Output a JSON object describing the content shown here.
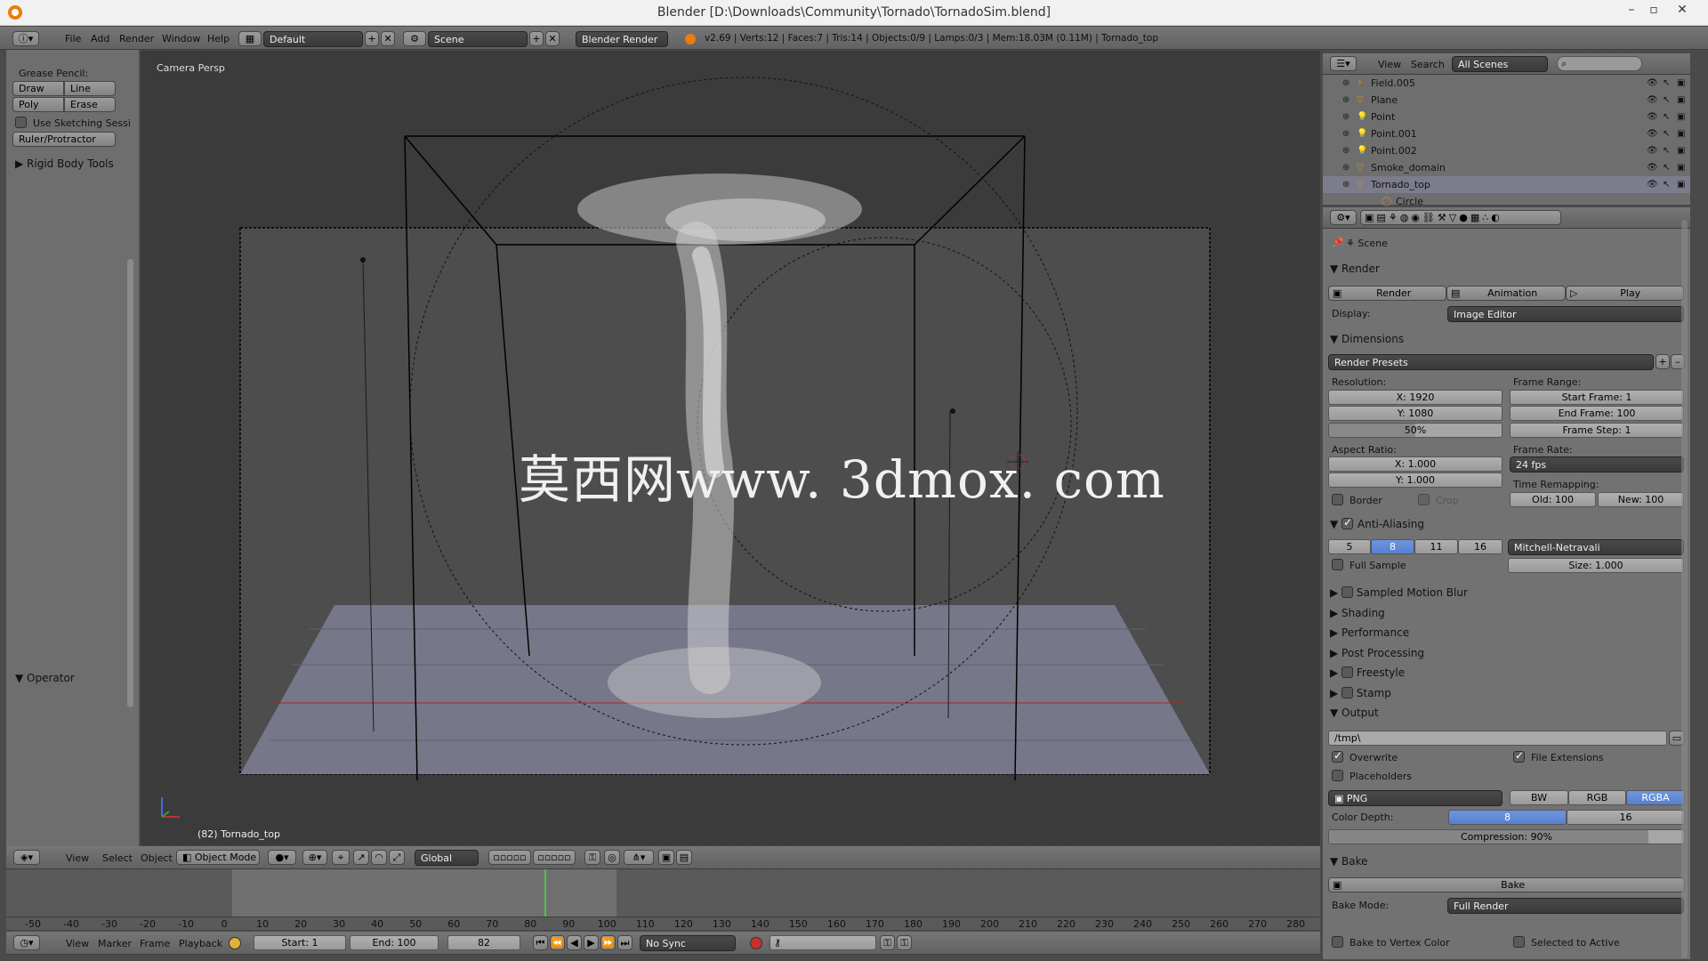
{
  "window": {
    "title": "Blender [D:\\Downloads\\Community\\Tornado\\TornadoSim.blend]"
  },
  "topbar": {
    "menus": [
      "File",
      "Add",
      "Render",
      "Window",
      "Help"
    ],
    "layout": "Default",
    "scene": "Scene",
    "engine": "Blender Render",
    "stats": "v2.69 | Verts:12 | Faces:7 | Tris:14 | Objects:0/9 | Lamps:0/3 | Mem:18.03M (0.11M) | Tornado_top"
  },
  "toolshelf": {
    "grease_pencil": "Grease Pencil:",
    "draw": "Draw",
    "line": "Line",
    "poly": "Poly",
    "erase": "Erase",
    "sketching": "Use Sketching Sessi",
    "ruler": "Ruler/Protractor",
    "rigid_body": "Rigid Body Tools",
    "operator": "Operator"
  },
  "viewport": {
    "persp_label": "Camera Persp",
    "object_label": "(82) Tornado_top",
    "watermark": "莫西网www. 3dmox. com",
    "header": {
      "menus": [
        "View",
        "Select",
        "Object"
      ],
      "mode": "Object Mode",
      "orientation": "Global"
    }
  },
  "outliner": {
    "menus": [
      "View",
      "Search"
    ],
    "scene_filter": "All Scenes",
    "items": [
      "Field.005",
      "Plane",
      "Point",
      "Point.001",
      "Point.002",
      "Smoke_domain",
      "Tornado_top",
      "Circle"
    ]
  },
  "properties": {
    "context": "Scene",
    "render": {
      "title": "Render",
      "render_btn": "Render",
      "animation_btn": "Animation",
      "play_btn": "Play",
      "display_label": "Display:",
      "display_value": "Image Editor"
    },
    "dimensions": {
      "title": "Dimensions",
      "presets": "Render Presets",
      "resolution_label": "Resolution:",
      "res_x": "X: 1920",
      "res_y": "Y: 1080",
      "res_pct": "50%",
      "frame_range_label": "Frame Range:",
      "start_frame": "Start Frame: 1",
      "end_frame": "End Frame: 100",
      "frame_step": "Frame Step: 1",
      "aspect_label": "Aspect Ratio:",
      "aspect_x": "X: 1.000",
      "aspect_y": "Y: 1.000",
      "frame_rate_label": "Frame Rate:",
      "frame_rate": "24 fps",
      "time_remap_label": "Time Remapping:",
      "old": "Old: 100",
      "new": "New: 100",
      "border": "Border",
      "crop": "Crop"
    },
    "anti_aliasing": {
      "title": "Anti-Aliasing",
      "samples": [
        "5",
        "8",
        "11",
        "16"
      ],
      "filter": "Mitchell-Netravali",
      "full_sample": "Full Sample",
      "size": "Size: 1.000"
    },
    "collapsed_panels": [
      "Sampled Motion Blur",
      "Shading",
      "Performance",
      "Post Processing",
      "Freestyle",
      "Stamp"
    ],
    "output": {
      "title": "Output",
      "path": "/tmp\\",
      "overwrite": "Overwrite",
      "file_extensions": "File Extensions",
      "placeholders": "Placeholders",
      "format": "PNG",
      "bw": "BW",
      "rgb": "RGB",
      "rgba": "RGBA",
      "color_depth_label": "Color Depth:",
      "depth_8": "8",
      "depth_16": "16",
      "compression": "Compression: 90%",
      "compression_level": 0.9
    },
    "bake": {
      "title": "Bake",
      "bake_btn": "Bake",
      "mode_label": "Bake Mode:",
      "mode_value": "Full Render",
      "to_vertex_color": "Bake to Vertex Color",
      "selected_to_active": "Selected to Active"
    }
  },
  "timeline": {
    "ticks": [
      "-50",
      "-40",
      "-30",
      "-20",
      "-10",
      "0",
      "10",
      "20",
      "30",
      "40",
      "50",
      "60",
      "70",
      "80",
      "90",
      "100",
      "110",
      "120",
      "130",
      "140",
      "150",
      "160",
      "170",
      "180",
      "190",
      "200",
      "210",
      "220",
      "230",
      "240",
      "250",
      "260",
      "270",
      "280"
    ],
    "menus": [
      "View",
      "Marker",
      "Frame",
      "Playback"
    ],
    "start": "Start: 1",
    "end": "End: 100",
    "current": "82",
    "sync": "No Sync"
  }
}
